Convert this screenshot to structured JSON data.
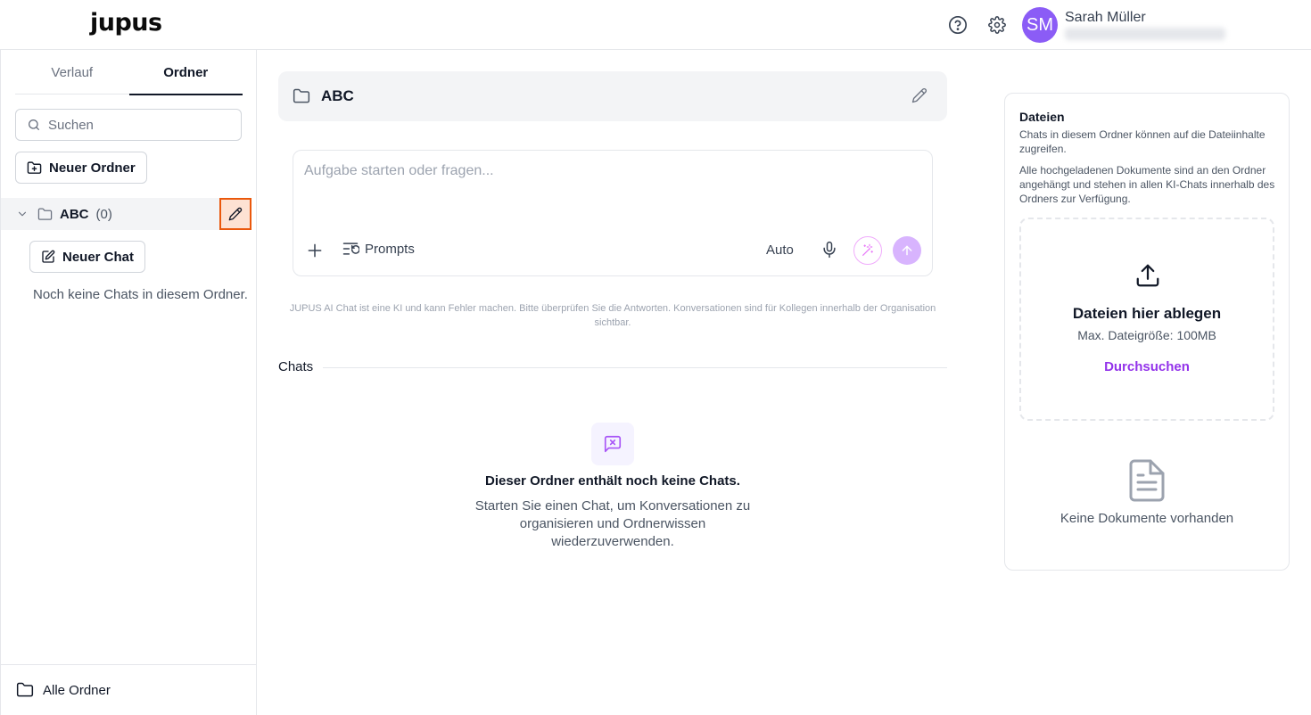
{
  "app": {
    "logo": "jupus"
  },
  "header": {
    "help_icon": "help-circle-icon",
    "settings_icon": "gear-icon",
    "avatar_initials": "SM",
    "avatar_color": "#8b5cf6",
    "user_name": "Sarah Müller"
  },
  "sidebar": {
    "tabs": [
      {
        "label": "Verlauf",
        "active": false
      },
      {
        "label": "Ordner",
        "active": true
      }
    ],
    "search_placeholder": "Suchen",
    "new_folder_label": "Neuer Ordner",
    "folder": {
      "name": "ABC",
      "count": "(0)",
      "expanded": true
    },
    "new_chat_label": "Neuer Chat",
    "empty_text": "Noch keine Chats in diesem Ordner.",
    "footer_label": "Alle Ordner"
  },
  "main": {
    "folder_title": "ABC",
    "composer": {
      "placeholder": "Aufgabe starten oder fragen...",
      "prompts_label": "Prompts",
      "mode_label": "Auto"
    },
    "disclaimer": "JUPUS AI Chat ist eine KI und kann Fehler machen. Bitte überprüfen Sie die Antworten. Konversationen sind für Kollegen innerhalb der Organisation sichtbar.",
    "chats_label": "Chats",
    "empty_title": "Dieser Ordner enthält noch keine Chats.",
    "empty_subtitle": "Starten Sie einen Chat, um Konversationen zu organisieren und Ordnerwissen wiederzuverwenden."
  },
  "files": {
    "title": "Dateien",
    "description_1": "Chats in diesem Ordner können auf die Dateiinhalte zugreifen.",
    "description_2": "Alle hochgeladenen Dokumente sind an den Ordner angehängt und stehen in allen KI-Chats innerhalb des Ordners zur Verfügung.",
    "drop_title": "Dateien hier ablegen",
    "drop_subtitle": "Max. Dateigröße: 100MB",
    "browse_label": "Durchsuchen",
    "empty_text": "Keine Dokumente vorhanden"
  },
  "colors": {
    "accent": "#9333ea",
    "highlight_border": "#ea580c",
    "send_button": "#d8b4fe"
  }
}
